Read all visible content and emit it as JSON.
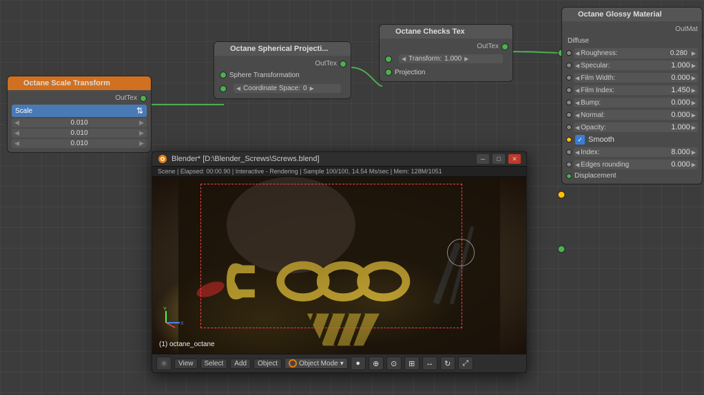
{
  "nodes": {
    "scaleTransform": {
      "title": "Octane Scale Transform",
      "outLabel": "OutTex",
      "dropdown": {
        "label": "Scale",
        "value": ""
      },
      "fields": [
        {
          "value": "0.010"
        },
        {
          "value": "0.010"
        },
        {
          "value": "0.010"
        }
      ]
    },
    "sphericalProj": {
      "title": "Octane Spherical Projecti...",
      "outLabel": "OutTex",
      "rows": [
        {
          "label": "Sphere Transformation",
          "socket": true
        },
        {
          "label": "Coordinate Space:",
          "value": "0"
        }
      ]
    },
    "checksTex": {
      "title": "Octane Checks Tex",
      "outLabel": "OutTex",
      "transformLabel": "Transform:",
      "transformValue": "1.000",
      "projLabel": "Projection"
    },
    "glossyMaterial": {
      "title": "Octane Glossy Material",
      "outLabel": "OutMat",
      "diffuseLabel": "Diffuse",
      "properties": [
        {
          "label": "Roughness:",
          "value": "0.280"
        },
        {
          "label": "Specular:",
          "value": "1.000"
        },
        {
          "label": "Film Width:",
          "value": "0.000"
        },
        {
          "label": "Film Index:",
          "value": "1.450"
        },
        {
          "label": "Bump:",
          "value": "0.000"
        },
        {
          "label": "Normal:",
          "value": "0.000"
        },
        {
          "label": "Opacity:",
          "value": "1.000"
        }
      ],
      "smooth": {
        "label": "Smooth",
        "checked": true
      },
      "indexLabel": "Index:",
      "indexValue": "8.000",
      "edgesLabel": "Edges rounding",
      "edgesValue": "0.000",
      "displacementLabel": "Displacement"
    }
  },
  "blenderWindow": {
    "title": "Blender* [D:\\Blender_Screws\\Screws.blend]",
    "status": "Scene | Elapsed: 00:00.90 | Interactive - Rendering | Sample 100/100, 14.54 Ms/sec | Mem: 128M/1051",
    "objectLabel": "(1) octane_octane",
    "toolbar": {
      "view": "View",
      "select": "Select",
      "add": "Add",
      "object": "Object",
      "mode": "Object Mode",
      "modeArrow": "▾"
    },
    "controls": {
      "minimize": "─",
      "maximize": "□",
      "close": "✕"
    }
  }
}
